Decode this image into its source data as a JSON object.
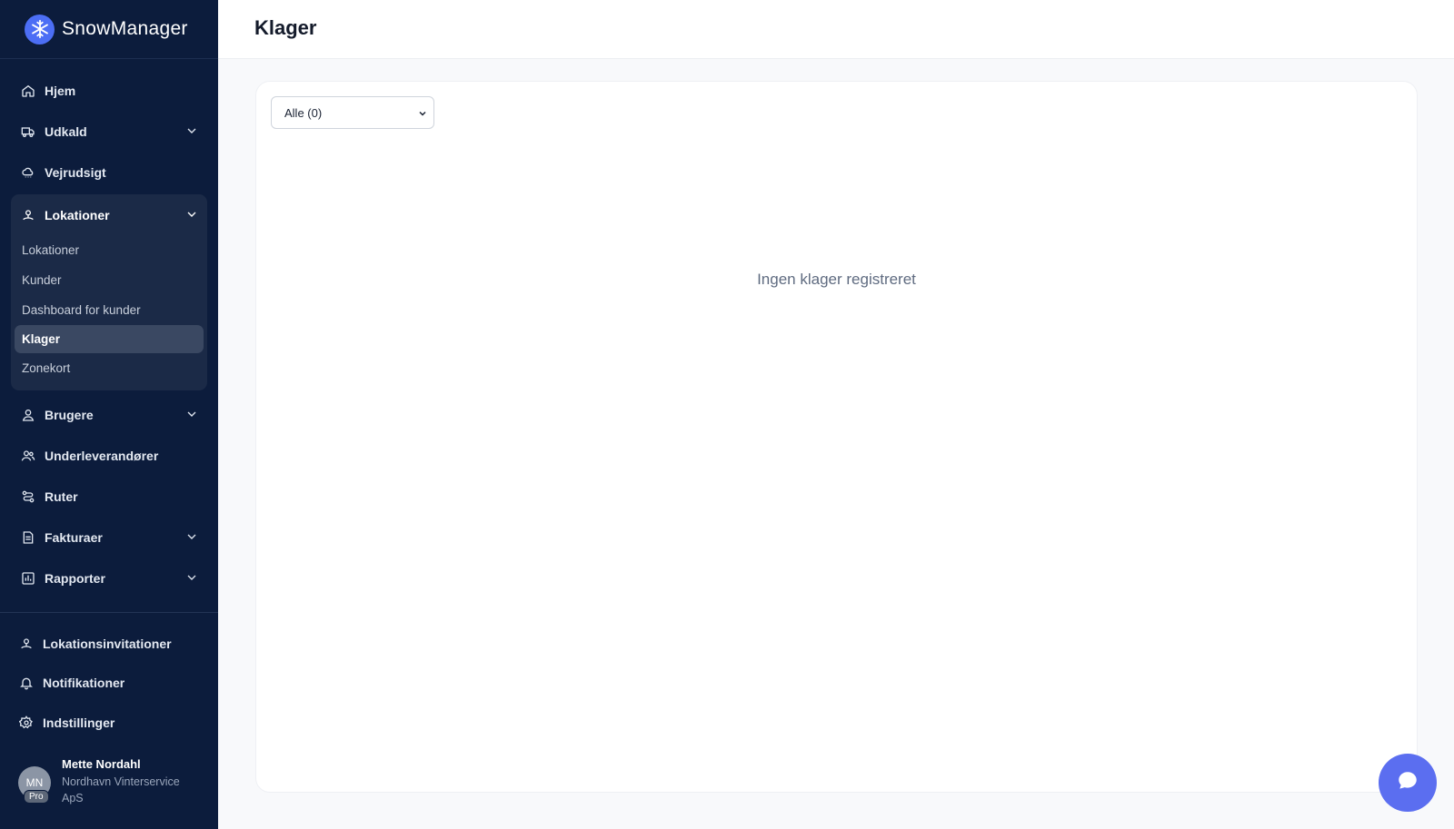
{
  "app": {
    "name": "SnowManager"
  },
  "sidebar": {
    "items": [
      {
        "label": "Hjem",
        "icon": "home-icon"
      },
      {
        "label": "Udkald",
        "icon": "truck-icon"
      },
      {
        "label": "Vejrudsigt",
        "icon": "weather-icon"
      }
    ],
    "group": {
      "label": "Lokationer",
      "icon": "location-pin-icon",
      "subitems": [
        "Lokationer",
        "Kunder",
        "Dashboard for kunder",
        "Klager",
        "Zonekort"
      ],
      "active": "Klager"
    },
    "items2": [
      {
        "label": "Brugere",
        "icon": "user-icon"
      },
      {
        "label": "Underleverandører",
        "icon": "users-icon"
      },
      {
        "label": "Ruter",
        "icon": "route-icon"
      },
      {
        "label": "Fakturaer",
        "icon": "invoice-icon"
      },
      {
        "label": "Rapporter",
        "icon": "chart-icon"
      }
    ],
    "bottom": [
      {
        "label": "Lokationsinvitationer",
        "icon": "location-pin-icon"
      },
      {
        "label": "Notifikationer",
        "icon": "bell-icon"
      },
      {
        "label": "Indstillinger",
        "icon": "gear-icon"
      }
    ]
  },
  "user": {
    "initials": "MN",
    "badge": "Pro",
    "name": "Mette Nordahl",
    "org": "Nordhavn Vinterservice ApS"
  },
  "header": {
    "title": "Klager"
  },
  "filter": {
    "selected": "Alle (0)"
  },
  "main": {
    "empty_text": "Ingen klager registreret"
  },
  "colors": {
    "sidebar": "#0c1c3c",
    "accent": "#5b6ef0",
    "brand": "#4c6ef5"
  }
}
